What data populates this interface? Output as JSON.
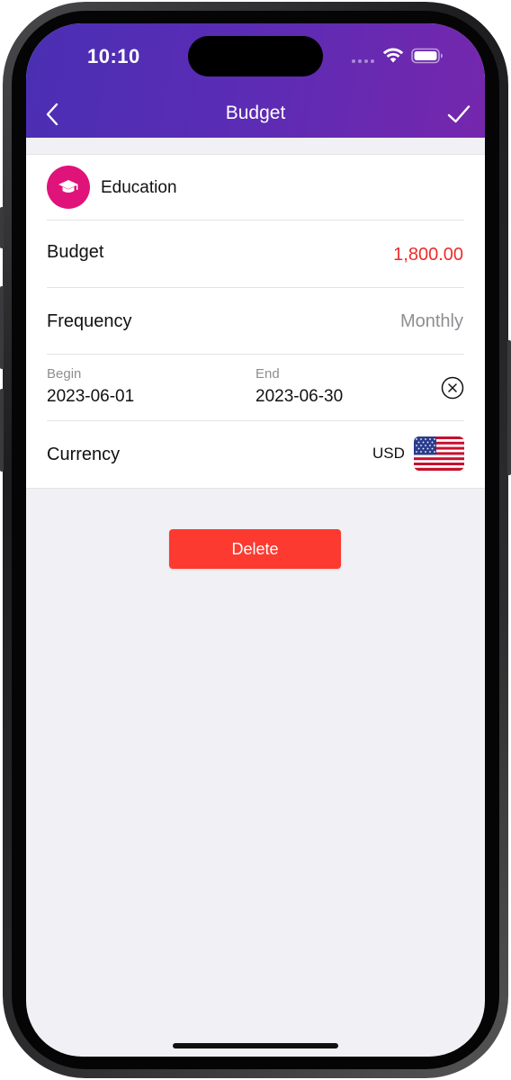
{
  "status_bar": {
    "time": "10:10",
    "icons": [
      "cellular-signal-icon",
      "wifi-icon",
      "battery-icon"
    ]
  },
  "nav": {
    "title": "Budget",
    "back_icon": "chevron-left-icon",
    "confirm_icon": "checkmark-icon"
  },
  "category": {
    "label": "Education",
    "icon": "graduation-cap-icon",
    "color": "#e0137a"
  },
  "budget": {
    "label": "Budget",
    "value": "1,800.00",
    "value_color": "#ef2b2b"
  },
  "frequency": {
    "label": "Frequency",
    "value": "Monthly"
  },
  "period": {
    "begin_label": "Begin",
    "begin_value": "2023-06-01",
    "end_label": "End",
    "end_value": "2023-06-30",
    "clear_icon": "clear-circle-x-icon"
  },
  "currency": {
    "label": "Currency",
    "code": "USD",
    "flag_icon": "us-flag-icon"
  },
  "actions": {
    "delete_label": "Delete",
    "delete_color": "#fc3a30"
  },
  "theme": {
    "header_gradient_start": "#4a2fb3",
    "header_gradient_end": "#7527ad",
    "background": "#f1f0f5"
  }
}
